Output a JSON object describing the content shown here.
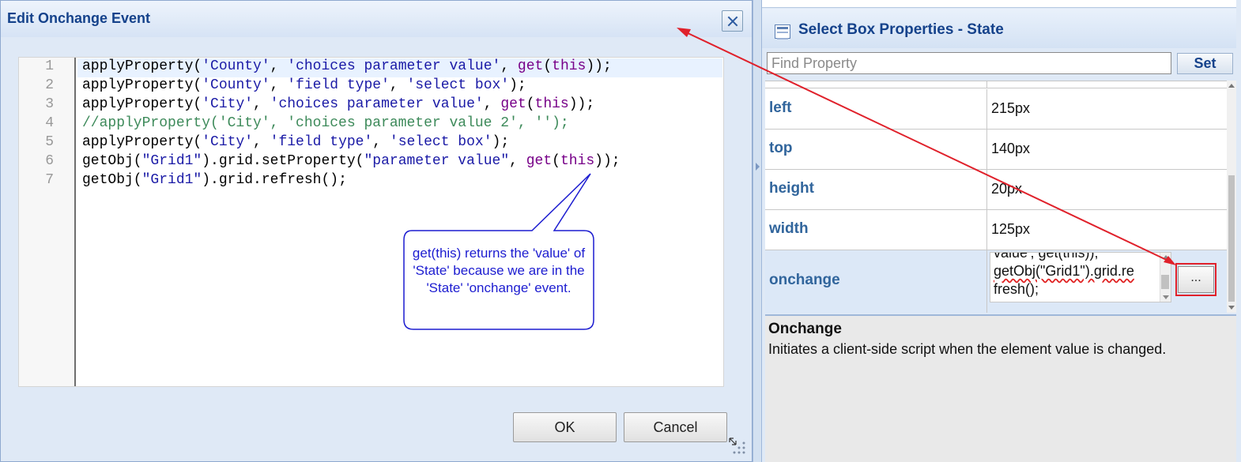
{
  "dialog": {
    "title": "Edit Onchange Event",
    "ok_label": "OK",
    "cancel_label": "Cancel"
  },
  "code_lines": [
    {
      "n": "1",
      "text": "applyProperty('County', 'choices parameter value', get(this));"
    },
    {
      "n": "2",
      "text": "applyProperty('County', 'field type', 'select box');"
    },
    {
      "n": "3",
      "text": "applyProperty('City', 'choices parameter value', get(this));"
    },
    {
      "n": "4",
      "text": "//applyProperty('City', 'choices parameter value 2', '');"
    },
    {
      "n": "5",
      "text": "applyProperty('City', 'field type', 'select box');"
    },
    {
      "n": "6",
      "text": "getObj(\"Grid1\").grid.setProperty(\"parameter value\", get(this));"
    },
    {
      "n": "7",
      "text": "getObj(\"Grid1\").grid.refresh();"
    }
  ],
  "callout_text": "get(this) returns the 'value' of 'State' because we are in the 'State' 'onchange' event.",
  "panel": {
    "title": "Select Box Properties - State",
    "find_placeholder": "Find Property",
    "set_label": "Set",
    "properties": [
      {
        "name": "left",
        "value": "215px"
      },
      {
        "name": "top",
        "value": "140px"
      },
      {
        "name": "height",
        "value": "20px"
      },
      {
        "name": "width",
        "value": "125px"
      }
    ],
    "onchange": {
      "name": "onchange",
      "value_lines": [
        "value', get(this));",
        "getObj(\"Grid1\").grid.re",
        "fresh();"
      ],
      "button_label": "..."
    },
    "description": {
      "title": "Onchange",
      "text": "Initiates a client-side script when the element value is changed."
    }
  },
  "colors": {
    "title_text": "#15428b",
    "property_name": "#31659c",
    "highlight": "#e0212b",
    "callout": "#1c1cd0"
  }
}
